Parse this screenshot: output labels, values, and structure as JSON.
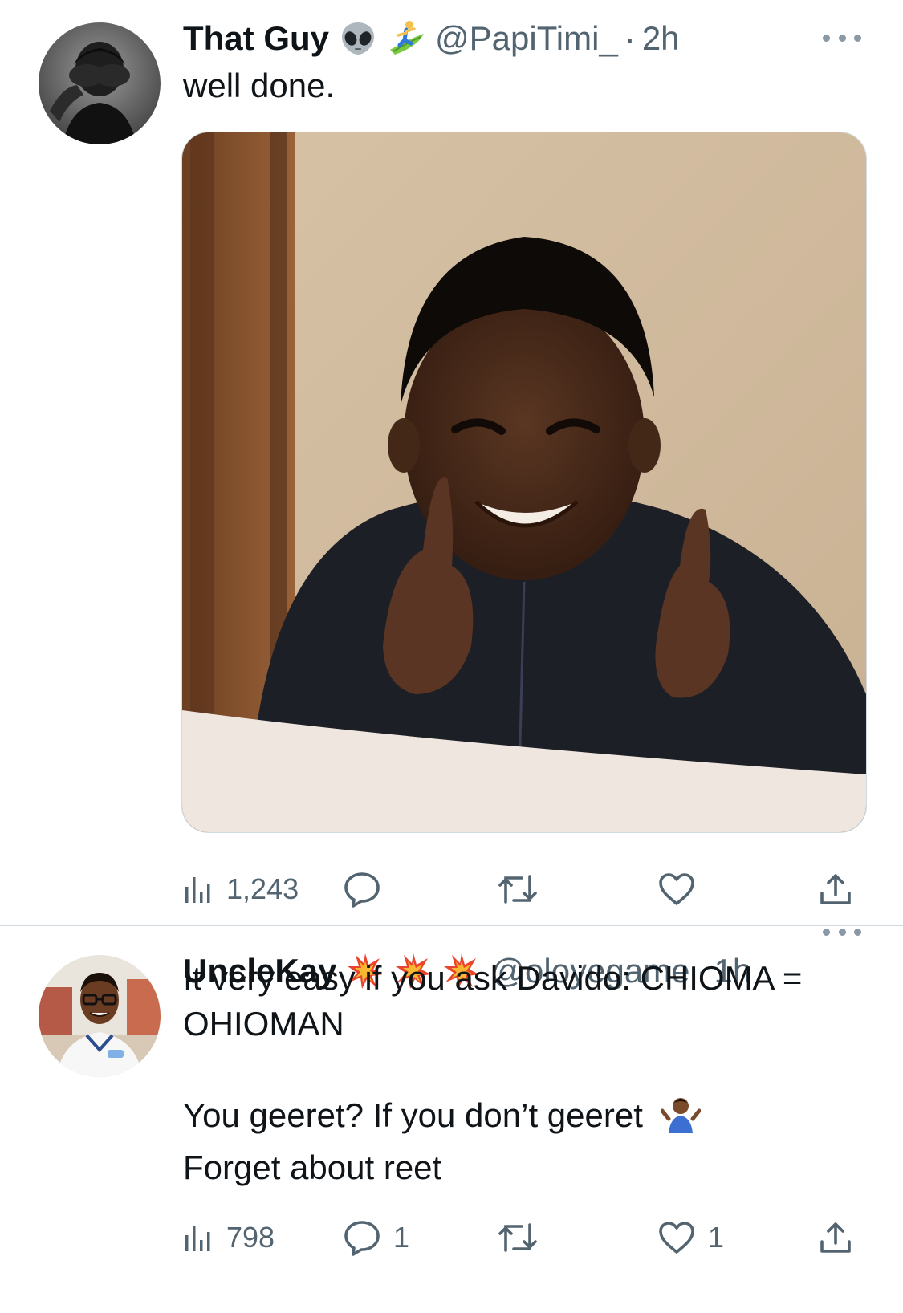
{
  "tweets": [
    {
      "name": "That Guy",
      "emojis": [
        "alien-emoji",
        "surfer-emoji"
      ],
      "handle": "@PapiTimi_",
      "separator": "·",
      "time": "2h",
      "text_lines": [
        "well done."
      ],
      "has_media": true,
      "media_description_icon": "thumbs-up-boy-photo",
      "stats": {
        "views": "1,243",
        "replies": "",
        "retweets": "",
        "likes": ""
      }
    },
    {
      "name": "UncleKay",
      "emojis": [
        "collision-emoji",
        "collision-emoji",
        "collision-emoji"
      ],
      "handle": "@oloyegame",
      "separator": "·",
      "time": "1h",
      "text_lines": [
        "It very easy if you ask Davido: CHIOMA =",
        "OHIOMAN",
        "",
        "You geeret? If you don’t geeret",
        "Forget about reet"
      ],
      "inline_emoji": "person-shrugging-emoji",
      "has_media": false,
      "stats": {
        "views": "798",
        "replies": "1",
        "retweets": "",
        "likes": "1"
      }
    }
  ],
  "colors": {
    "text": "#0f1419",
    "secondary": "#536471",
    "divider": "#cfd9de"
  }
}
